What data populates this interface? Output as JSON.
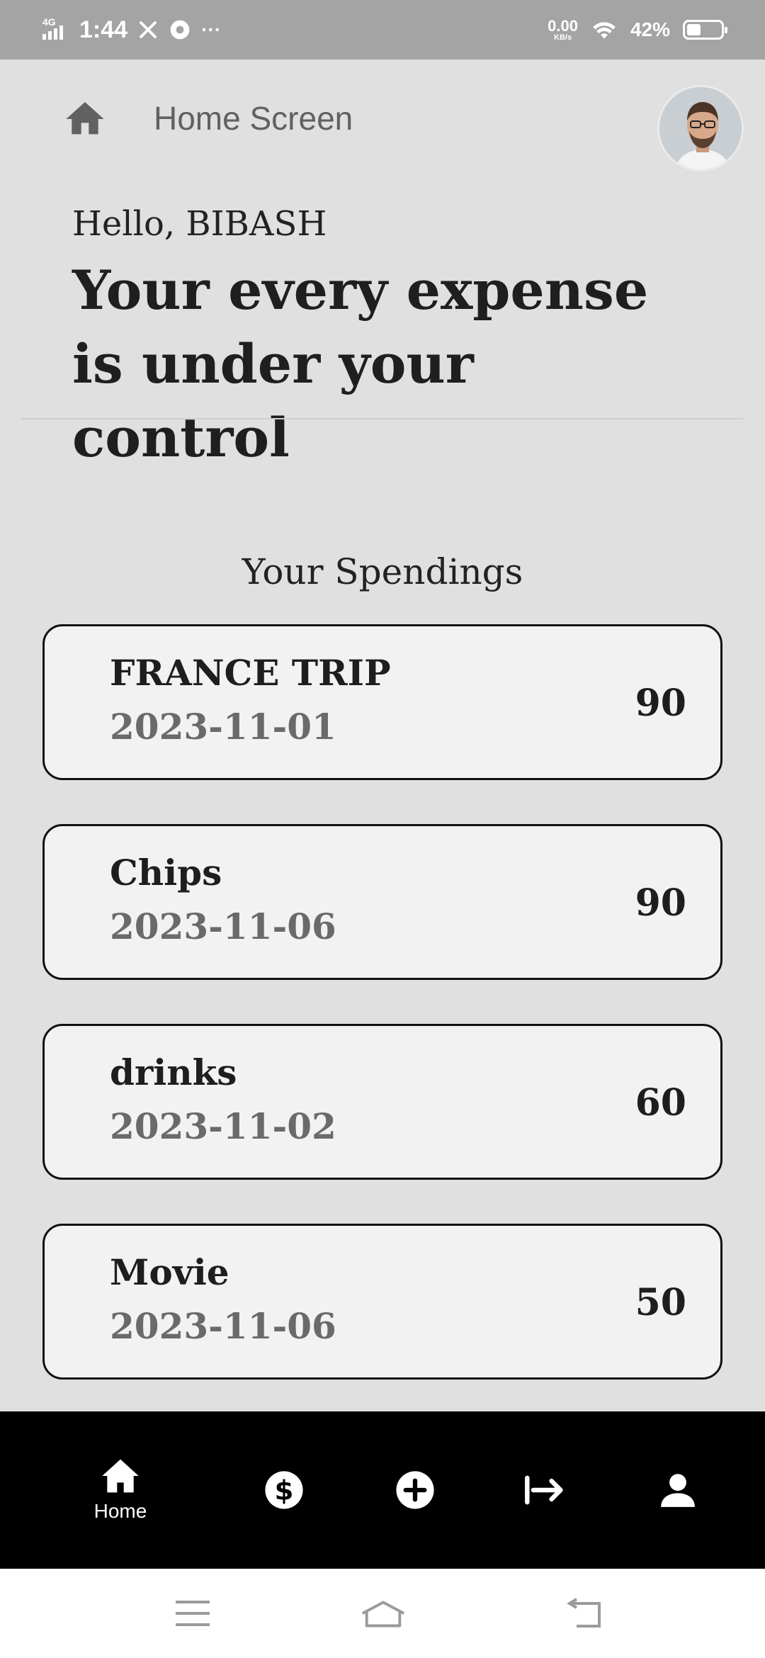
{
  "status_bar": {
    "network": "4G",
    "time": "1:44",
    "more": "···",
    "speed_value": "0.00",
    "speed_unit": "KB/s",
    "battery": "42%",
    "battery_level": 0.42
  },
  "appbar": {
    "title": "Home Screen",
    "home_icon": "home-icon",
    "avatar": "user-avatar"
  },
  "greeting": "Hello, BIBASH",
  "headline": "Your every expense is under your control",
  "section_title": "Your Spendings",
  "spendings": [
    {
      "name": "FRANCE TRIP",
      "date": "2023-11-01",
      "amount": "90"
    },
    {
      "name": "Chips",
      "date": "2023-11-06",
      "amount": "90"
    },
    {
      "name": "drinks",
      "date": "2023-11-02",
      "amount": "60"
    },
    {
      "name": "Movie",
      "date": "2023-11-06",
      "amount": "50"
    }
  ],
  "bottom_nav": {
    "home_label": "Home",
    "items": [
      "home-icon",
      "dollar-icon",
      "add-icon",
      "logout-icon",
      "person-icon"
    ]
  },
  "system_nav": [
    "menu-icon",
    "home-outline-icon",
    "back-icon"
  ],
  "colors": {
    "status_bar": "#a4a4a4",
    "background": "#e0e0e0",
    "card": "#f2f2f2",
    "bottom_nav": "#000000"
  }
}
